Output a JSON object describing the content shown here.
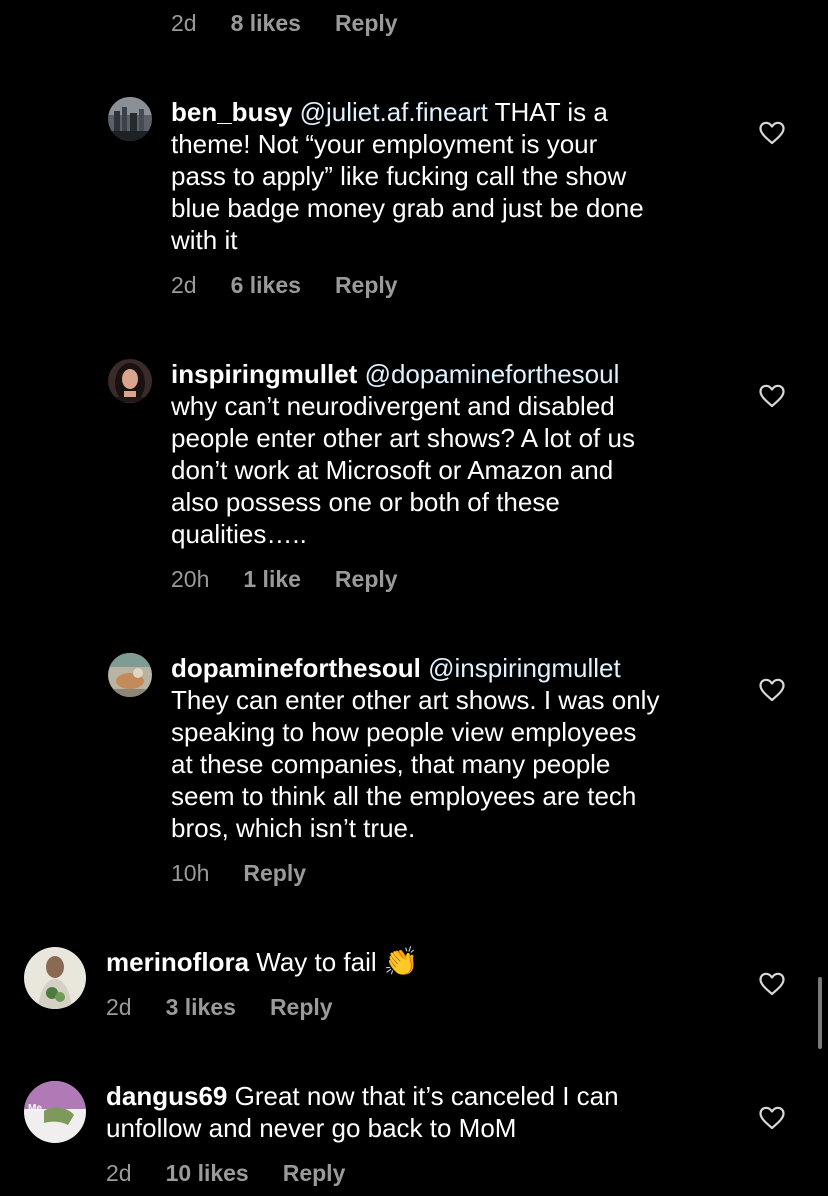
{
  "comments": [
    {
      "id": "top",
      "time": "2d",
      "likes": "8 likes",
      "reply": "Reply"
    },
    {
      "id": "ben_busy",
      "username": "ben_busy",
      "mention": "@juliet.af.fineart",
      "lines": [
        "THAT is a",
        "theme! Not “your employment is your",
        "pass to apply” like fucking call the show",
        "blue badge money grab and just be done",
        "with it"
      ],
      "time": "2d",
      "likes": "6 likes",
      "reply": "Reply"
    },
    {
      "id": "inspiringmullet",
      "username": "inspiringmullet",
      "mention": "@dopamineforthesoul",
      "lines": [
        "why can’t neurodivergent and disabled",
        "people enter other art shows? A lot of us",
        "don’t work at Microsoft or Amazon and",
        "also possess one or both of these",
        "qualities….."
      ],
      "time": "20h",
      "likes": "1 like",
      "reply": "Reply"
    },
    {
      "id": "dopamineforthesoul",
      "username": "dopamineforthesoul",
      "mention": "@inspiringmullet",
      "lines": [
        "They can enter other art shows. I was only",
        "speaking to how people view employees",
        "at these companies, that many people",
        "seem to think all the employees are tech",
        "bros, which isn’t true."
      ],
      "time": "10h",
      "reply": "Reply"
    },
    {
      "id": "merinoflora",
      "username": "merinoflora",
      "text": "Way to fail",
      "emoji": "👏",
      "time": "2d",
      "likes": "3 likes",
      "reply": "Reply"
    },
    {
      "id": "dangus69",
      "username": "dangus69",
      "lines": [
        "Great now that it’s canceled I can",
        "unfollow and never go back to MoM"
      ],
      "avatar_text": "Me",
      "time": "2d",
      "likes": "10 likes",
      "reply": "Reply"
    }
  ],
  "colors": {
    "background": "#000000",
    "text": "#ffffff",
    "meta": "#9a9a9a",
    "mention": "#e0f1ff",
    "heart": "#d8d8d8"
  },
  "icons": [
    "heart-outline-icon",
    "clapping-hands-emoji"
  ]
}
